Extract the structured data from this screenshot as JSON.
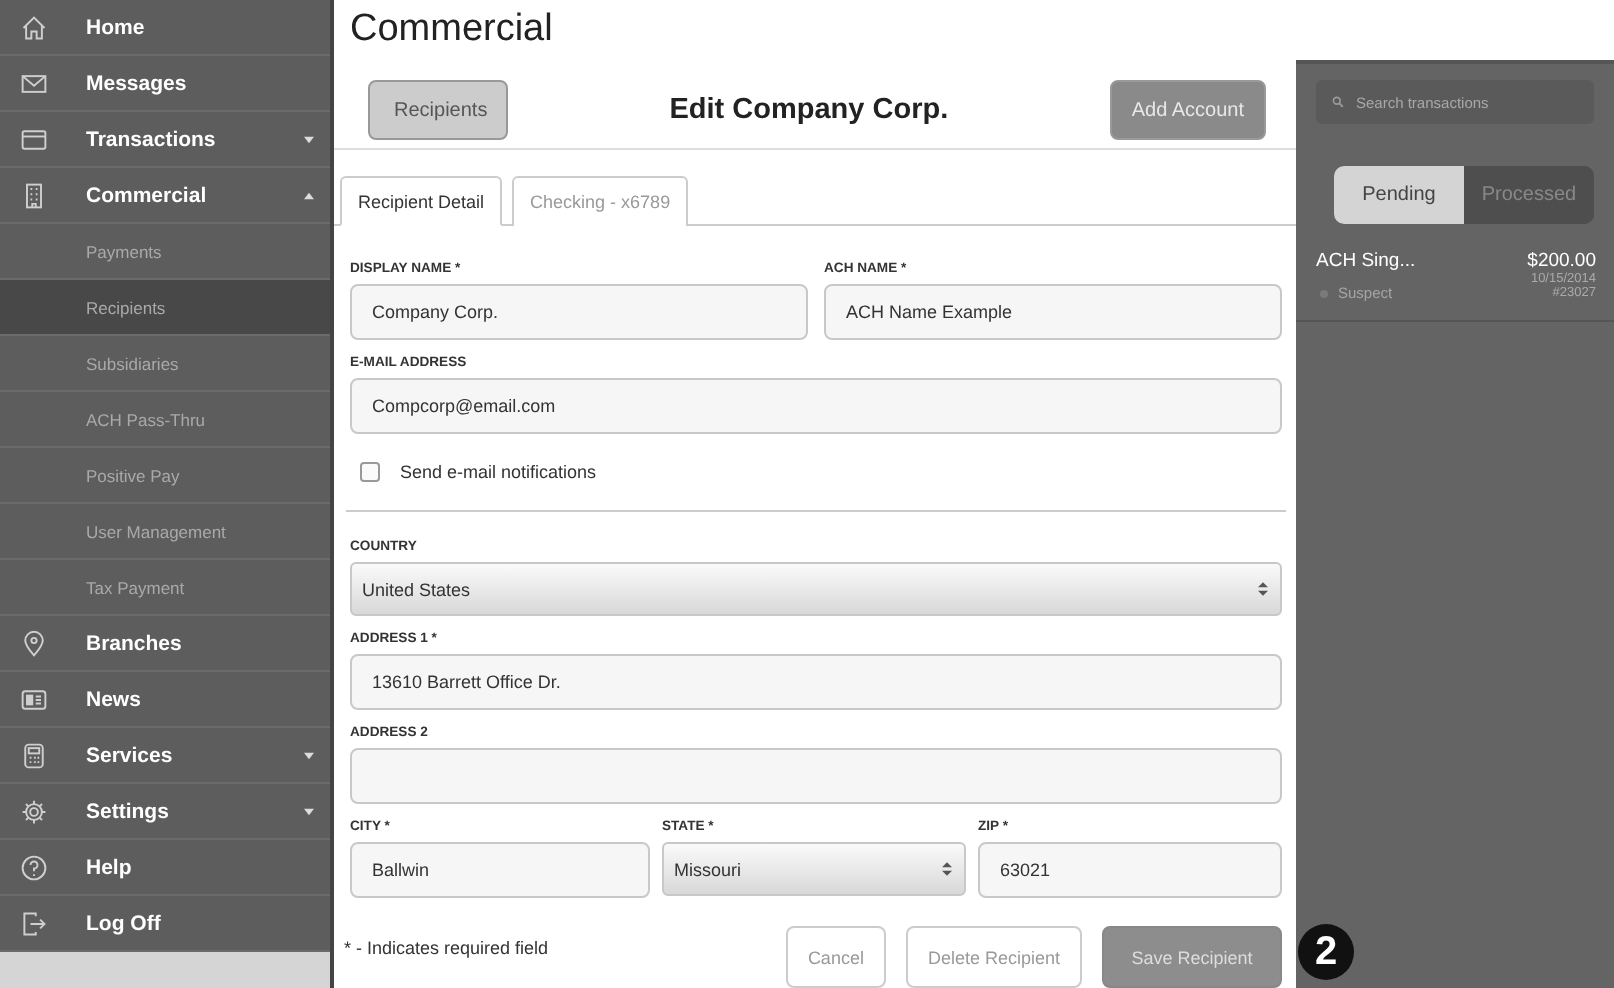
{
  "sidebar": {
    "items": [
      {
        "label": "Home",
        "selected": false
      },
      {
        "label": "Messages",
        "selected": false
      },
      {
        "label": "Transactions",
        "selected": false,
        "expanded": false
      },
      {
        "label": "Commercial",
        "selected": false,
        "expanded": true,
        "children": [
          {
            "label": "Payments",
            "selected": false
          },
          {
            "label": "Recipients",
            "selected": true
          },
          {
            "label": "Subsidiaries",
            "selected": false
          },
          {
            "label": "ACH Pass-Thru",
            "selected": false
          },
          {
            "label": "Positive Pay",
            "selected": false
          },
          {
            "label": "User Management",
            "selected": false
          },
          {
            "label": "Tax Payment",
            "selected": false
          }
        ]
      },
      {
        "label": "Branches",
        "selected": false
      },
      {
        "label": "News",
        "selected": false
      },
      {
        "label": "Services",
        "selected": false,
        "expanded": false
      },
      {
        "label": "Settings",
        "selected": false,
        "expanded": false
      },
      {
        "label": "Help",
        "selected": false
      },
      {
        "label": "Log Off",
        "selected": false
      }
    ]
  },
  "page_title": "Commercial",
  "toolbar": {
    "back_button": "Recipients",
    "title": "Edit Company Corp.",
    "action_button": "Add Account"
  },
  "tabs": [
    {
      "label": "Recipient Detail",
      "selected": true
    },
    {
      "label": "Checking - x6789",
      "selected": false
    }
  ],
  "contact_rows": [
    [
      {
        "label": "DISPLAY NAME *",
        "value": "Company Corp.",
        "kind": "text"
      },
      {
        "label": "ACH NAME *",
        "value": "ACH Name Example",
        "kind": "text"
      }
    ],
    [
      {
        "label": "E-MAIL ADDRESS",
        "value": "Compcorp@email.com",
        "kind": "text"
      }
    ]
  ],
  "notification": {
    "label": "Send e-mail notifications",
    "checked": false
  },
  "address_rows": [
    [
      {
        "label": "COUNTRY",
        "value": "United States",
        "kind": "select"
      }
    ],
    [
      {
        "label": "ADDRESS 1 *",
        "value": "13610 Barrett Office Dr.",
        "kind": "text"
      }
    ],
    [
      {
        "label": "ADDRESS 2",
        "kind": "text"
      }
    ],
    [
      {
        "label": "CITY *",
        "value": "Ballwin",
        "kind": "text"
      },
      {
        "label": "STATE *",
        "value": "Missouri",
        "kind": "select"
      },
      {
        "label": "ZIP *",
        "value": "63021",
        "kind": "text"
      }
    ]
  ],
  "required_note": "* - Indicates required field",
  "buttons": [
    {
      "label": "Cancel",
      "kind": "outline"
    },
    {
      "label": "Delete Recipient",
      "kind": "outline"
    },
    {
      "label": "Save Recipient",
      "kind": "primary"
    }
  ],
  "callout": "2",
  "transactions_panel": {
    "search": {
      "placeholder": "Search transactions"
    },
    "segments": [
      {
        "label": "Pending",
        "selected": true
      },
      {
        "label": "Processed",
        "selected": false
      }
    ],
    "items": [
      {
        "name": "ACH Sing...",
        "amount": "$200.00",
        "date": "10/15/2014",
        "number": "#23027",
        "status": "Suspect"
      }
    ]
  }
}
